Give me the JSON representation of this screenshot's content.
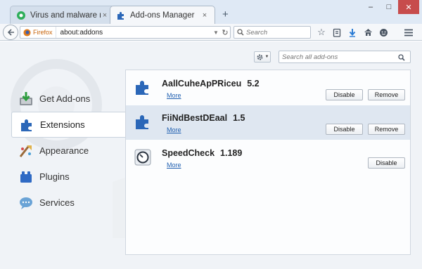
{
  "tabs": [
    {
      "label": "Virus and malware removal...",
      "close": "×"
    },
    {
      "label": "Add-ons Manager",
      "close": "×"
    }
  ],
  "new_tab": "+",
  "window_controls": {
    "minimize": "–",
    "maximize": "□",
    "close": "✕"
  },
  "navbar": {
    "identity_label": "Firefox",
    "url": "about:addons",
    "search_placeholder": "Search"
  },
  "addons": {
    "search_placeholder": "Search all add-ons",
    "categories": [
      {
        "label": "Get Add-ons"
      },
      {
        "label": "Extensions"
      },
      {
        "label": "Appearance"
      },
      {
        "label": "Plugins"
      },
      {
        "label": "Services"
      }
    ],
    "selected_category": "Extensions",
    "extensions": [
      {
        "name": "AallCuheApPRiceu",
        "version": "5.2",
        "more": "More",
        "disable": "Disable",
        "remove": "Remove"
      },
      {
        "name": "FiiNdBestDEaal",
        "version": "1.5",
        "more": "More",
        "disable": "Disable",
        "remove": "Remove"
      },
      {
        "name": "SpeedCheck",
        "version": "1.189",
        "more": "More",
        "disable": "Disable"
      }
    ]
  },
  "colors": {
    "accent_blue": "#1f5fb0",
    "firefox_orange": "#c8640a",
    "close_red": "#c74c4c",
    "selected_row": "#dfe7f1"
  }
}
